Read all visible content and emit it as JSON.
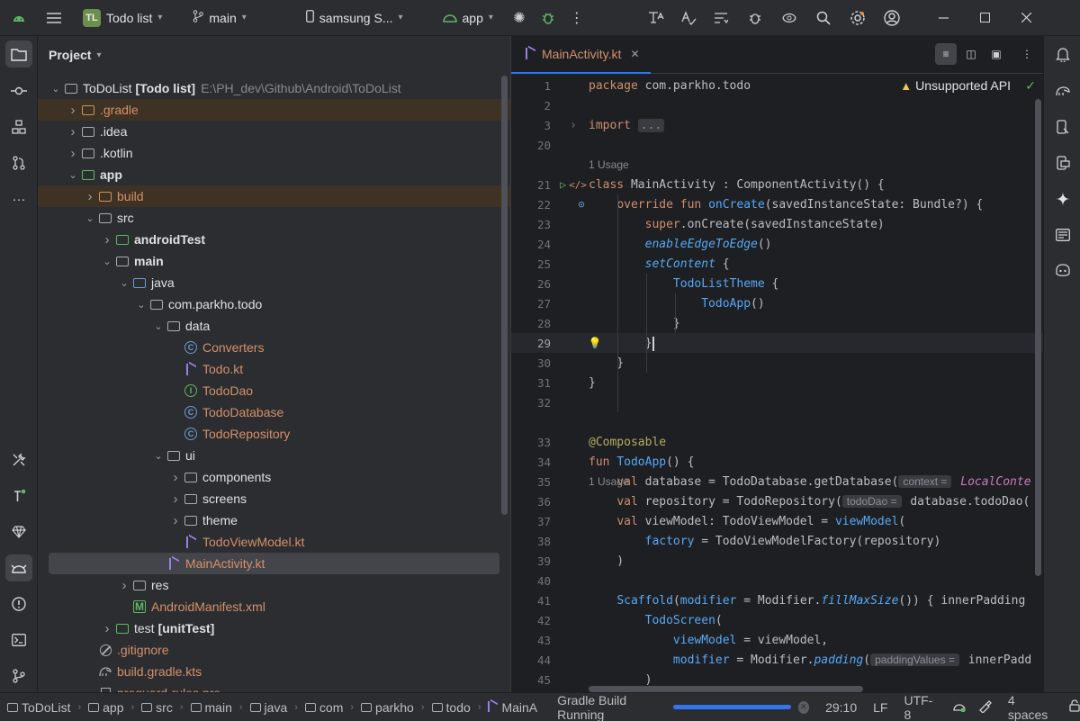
{
  "titlebar": {
    "project_badge": "TL",
    "project_name": "Todo list",
    "branch": "main",
    "device": "samsung S...",
    "run_config": "app"
  },
  "project_panel": {
    "title": "Project",
    "tree": [
      {
        "label": "ToDoList",
        "extra": "[Todo list]",
        "path": "E:\\PH_dev\\Github\\Android\\ToDoList",
        "depth": 0,
        "arrow": "down",
        "icon": "folder"
      },
      {
        "label": ".gradle",
        "depth": 1,
        "arrow": "right",
        "icon": "folder-orange",
        "highlight": true,
        "color": "orange"
      },
      {
        "label": ".idea",
        "depth": 1,
        "arrow": "right",
        "icon": "folder"
      },
      {
        "label": ".kotlin",
        "depth": 1,
        "arrow": "right",
        "icon": "folder"
      },
      {
        "label": "app",
        "depth": 1,
        "arrow": "down",
        "icon": "folder-module",
        "bold": true
      },
      {
        "label": "build",
        "depth": 2,
        "arrow": "right",
        "icon": "folder-orange",
        "highlight": true,
        "color": "orange"
      },
      {
        "label": "src",
        "depth": 2,
        "arrow": "down",
        "icon": "folder"
      },
      {
        "label": "androidTest",
        "depth": 3,
        "arrow": "right",
        "icon": "folder-green",
        "bold": true
      },
      {
        "label": "main",
        "depth": 3,
        "arrow": "down",
        "icon": "folder",
        "bold": true
      },
      {
        "label": "java",
        "depth": 4,
        "arrow": "down",
        "icon": "folder-blue"
      },
      {
        "label": "com.parkho.todo",
        "depth": 5,
        "arrow": "down",
        "icon": "folder"
      },
      {
        "label": "data",
        "depth": 6,
        "arrow": "down",
        "icon": "folder"
      },
      {
        "label": "Converters",
        "depth": 7,
        "arrow": "",
        "icon": "class",
        "color": "orange"
      },
      {
        "label": "Todo.kt",
        "depth": 7,
        "arrow": "",
        "icon": "kotlin",
        "color": "orange"
      },
      {
        "label": "TodoDao",
        "depth": 7,
        "arrow": "",
        "icon": "interface",
        "color": "orange"
      },
      {
        "label": "TodoDatabase",
        "depth": 7,
        "arrow": "",
        "icon": "class",
        "color": "orange"
      },
      {
        "label": "TodoRepository",
        "depth": 7,
        "arrow": "",
        "icon": "class",
        "color": "orange"
      },
      {
        "label": "ui",
        "depth": 6,
        "arrow": "down",
        "icon": "folder"
      },
      {
        "label": "components",
        "depth": 7,
        "arrow": "right",
        "icon": "folder"
      },
      {
        "label": "screens",
        "depth": 7,
        "arrow": "right",
        "icon": "folder"
      },
      {
        "label": "theme",
        "depth": 7,
        "arrow": "right",
        "icon": "folder"
      },
      {
        "label": "TodoViewModel.kt",
        "depth": 7,
        "arrow": "",
        "icon": "kotlin",
        "color": "orange"
      },
      {
        "label": "MainActivity.kt",
        "depth": 6,
        "arrow": "",
        "icon": "kotlin",
        "color": "orange",
        "selected": true
      },
      {
        "label": "res",
        "depth": 4,
        "arrow": "right",
        "icon": "folder"
      },
      {
        "label": "AndroidManifest.xml",
        "depth": 4,
        "arrow": "",
        "icon": "manifest",
        "color": "orange"
      },
      {
        "label": "test",
        "extra": "[unitTest]",
        "depth": 3,
        "arrow": "right",
        "icon": "folder-green"
      },
      {
        "label": ".gitignore",
        "depth": 2,
        "arrow": "",
        "icon": "ignore",
        "color": "orange"
      },
      {
        "label": "build.gradle.kts",
        "depth": 2,
        "arrow": "",
        "icon": "gradle",
        "color": "orange"
      },
      {
        "label": "proguard-rules.pro",
        "depth": 2,
        "arrow": "",
        "icon": "file",
        "color": "orange"
      }
    ]
  },
  "editor": {
    "tab_label": "MainActivity.kt",
    "warning": "Unsupported API",
    "usage_label": "1 Usage",
    "lines": [
      {
        "n": "1",
        "html": "<span class='k'>package</span> com.parkho.todo"
      },
      {
        "n": "2",
        "html": ""
      },
      {
        "n": "3",
        "html": "<span class='k'>import</span> <span class='fold'>...</span>"
      },
      {
        "n": "20",
        "html": ""
      },
      {
        "n": "21",
        "html": "<span class='k'>class</span> MainActivity : ComponentActivity() {"
      },
      {
        "n": "22",
        "html": "    <span class='k'>override fun</span> <span class='fn'>onCreate</span>(savedInstanceState: Bundle?) {"
      },
      {
        "n": "23",
        "html": "        <span class='k'>super</span>.onCreate(savedInstanceState)"
      },
      {
        "n": "24",
        "html": "        <span class='it'>enableEdgeToEdge</span>()"
      },
      {
        "n": "25",
        "html": "        <span class='it'>setContent</span> {"
      },
      {
        "n": "26",
        "html": "            <span class='comp'>TodoListTheme</span> {"
      },
      {
        "n": "27",
        "html": "                <span class='comp'>TodoApp</span>()"
      },
      {
        "n": "28",
        "html": "            }"
      },
      {
        "n": "29",
        "html": "        }"
      },
      {
        "n": "30",
        "html": "    }"
      },
      {
        "n": "31",
        "html": "}"
      },
      {
        "n": "32",
        "html": ""
      },
      {
        "n": "33",
        "html": "<span class='ann'>@Composable</span>"
      },
      {
        "n": "34",
        "html": "<span class='k'>fun</span> <span class='fn'>TodoApp</span>() {"
      },
      {
        "n": "35",
        "html": "    <span class='k'>val</span> database = TodoDatabase.getDatabase(<span class='hint'>context =</span> <span class='purple-it'>LocalConte</span>"
      },
      {
        "n": "36",
        "html": "    <span class='k'>val</span> repository = TodoRepository(<span class='hint'>todoDao =</span> database.todoDao("
      },
      {
        "n": "37",
        "html": "    <span class='k'>val</span> viewModel: TodoViewModel = <span class='fn'>viewModel</span>("
      },
      {
        "n": "38",
        "html": "        <span class='cm'>factory</span> = TodoViewModelFactory(repository)"
      },
      {
        "n": "39",
        "html": "    )"
      },
      {
        "n": "40",
        "html": ""
      },
      {
        "n": "41",
        "html": "    <span class='comp'>Scaffold</span>(<span class='cm'>modifier</span> = Modifier.<span class='it'>fillMaxSize</span>()) { innerPadding"
      },
      {
        "n": "42",
        "html": "        <span class='comp'>TodoScreen</span>("
      },
      {
        "n": "43",
        "html": "            <span class='cm'>viewModel</span> = viewModel,"
      },
      {
        "n": "44",
        "html": "            <span class='cm'>modifier</span> = Modifier.<span class='it'>padding</span>(<span class='hint'>paddingValues =</span> innerPadd"
      },
      {
        "n": "45",
        "html": "        )"
      }
    ]
  },
  "statusbar": {
    "breadcrumbs": [
      "ToDoList",
      "app",
      "src",
      "main",
      "java",
      "com",
      "parkho",
      "todo",
      "MainA"
    ],
    "task": "Gradle Build Running",
    "progress": 1.0,
    "position": "29:10",
    "line_sep": "LF",
    "encoding": "UTF-8",
    "indent": "4 spaces"
  },
  "colors": {
    "accent": "#3574f0",
    "panel": "#2b2d30",
    "editor_bg": "#1e1f22",
    "keyword": "#cf8e6d",
    "function": "#56a8f5",
    "annotation": "#b3ae60",
    "modified_file": "#d6906a"
  }
}
